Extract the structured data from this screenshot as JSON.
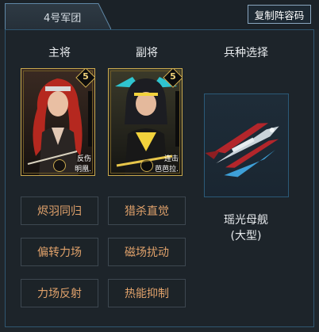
{
  "header": {
    "legion_tab": "4号军团",
    "copy_button": "复制阵容码"
  },
  "columns": {
    "main_general": "主将",
    "vice_general": "副将",
    "troop_select": "兵种选择"
  },
  "main_card": {
    "stars": "5",
    "tag": "反伤",
    "name": "明凰."
  },
  "vice_card": {
    "stars": "5",
    "tag": "连击",
    "name": "芭芭拉."
  },
  "troop": {
    "name_line1": "瑶光母舰",
    "name_line2": "(大型)"
  },
  "skills": [
    "烬羽同归",
    "猎杀直觉",
    "偏转力场",
    "磁场扰动",
    "力场反射",
    "热能抑制"
  ],
  "colors": {
    "background": "#1f262c",
    "panel_border": "#2f5670",
    "skill_text": "#e1a26b",
    "card_gold": "#c9a94e"
  }
}
